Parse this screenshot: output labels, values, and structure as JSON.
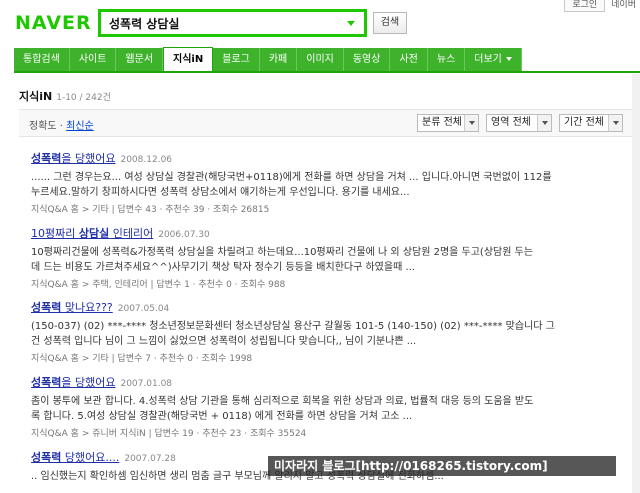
{
  "top": {
    "login": "로그인",
    "link": "네이버"
  },
  "logo": "NAVER",
  "search": {
    "query": "성폭력 상담실",
    "button": "검색"
  },
  "tabs": [
    "통합검색",
    "사이트",
    "웹문서",
    "지식iN",
    "블로그",
    "카페",
    "이미지",
    "동영상",
    "사전",
    "뉴스",
    "더보기"
  ],
  "section": {
    "title": "지식iN",
    "count": "1-10 / 242건"
  },
  "filter": {
    "sort_label": "정확도 ·",
    "sort_selected": "최신순",
    "dropdowns": [
      "분류 전체",
      "영역 전체",
      "기간 전체"
    ]
  },
  "results": [
    {
      "title_pre": "",
      "title_bold": "성폭력",
      "title_post": "을 당했어요",
      "date": "2008.12.06",
      "desc_line1": "...... 그런 경우는요... 여성 상담실 경찰관(해당국번+0118)에게 전화를 하면 상담을 거쳐 ... 입니다.아니면 국번없이 112를",
      "desc_line2": "누르세요.말하기 창피하시다면 성폭력 상담소에서 얘기하는게 우선입니다. 용기를 내세요...",
      "meta": "지식Q&A 홈 > 기타 | 답변수 43 · 추천수 39 · 조회수 26815"
    },
    {
      "title_pre": "10평짜리 ",
      "title_bold": "상담실",
      "title_post": " 인테리어",
      "date": "2006.07.30",
      "desc_line1": "10평짜리건물에 성폭력&가정폭력 상담실을 차릴려고 하는데요...10평짜리 건물에 나 외 상담원 2명을 두고(상담원 두는",
      "desc_line2": "데 드는 비용도 가르쳐주세요^^)사무기기 책상 탁자 정수기 등등을 배치한다구 하였을때 ...",
      "meta": "지식Q&A 홈 > 주택, 인테리어 | 답변수 1 · 추천수 0 · 조회수 988"
    },
    {
      "title_pre": "",
      "title_bold": "성폭력",
      "title_post": " 맞나요???",
      "date": "2007.05.04",
      "desc_line1": "(150-037) (02) ***-**** 청소년정보문화센터 청소년상담실 용산구 갈월동 101-5 (140-150) (02) ***-**** 맞습니다 그",
      "desc_line2": "건 성폭력 입니다 님이 그 느낌이 싫었으면 성폭력이 성립됩니다 맞습니다,, 님이 기분나쁜 ...",
      "meta": "지식Q&A 홈 > 기타 | 답변수 7 · 추천수 0 · 조회수 1998"
    },
    {
      "title_pre": "",
      "title_bold": "성폭력",
      "title_post": "을 당했어요",
      "date": "2007.01.08",
      "desc_line1": "좀이 봉투에 보관 합니다. 4.성폭력 상담 기관을 통해 심리적으로 회복을 위한 상담과 의료, 법률적 대응 등의 도움을 받도",
      "desc_line2": "록 합니다. 5.여성 상담실 경찰관(해당국번 + 0118) 에게 전화를 하면 상담을 거쳐 고소 ...",
      "meta": "지식Q&A 홈 > 쥬니버 지식iN | 답변수 19 · 추천수 23 · 조회수 35524"
    },
    {
      "title_pre": "",
      "title_bold": "성폭력",
      "title_post": " 당했어요....",
      "date": "2007.07.28",
      "desc_line1": ".. 임신했는지 확인하셈 임신하면 생리 멈춤 글구 부모님께 알리지 말고 성폭력 상담실에 전화하셈...",
      "desc_line2": "",
      "meta": ""
    }
  ],
  "watermark": "미자라지 블로그[http://0168265.tistory.com]"
}
